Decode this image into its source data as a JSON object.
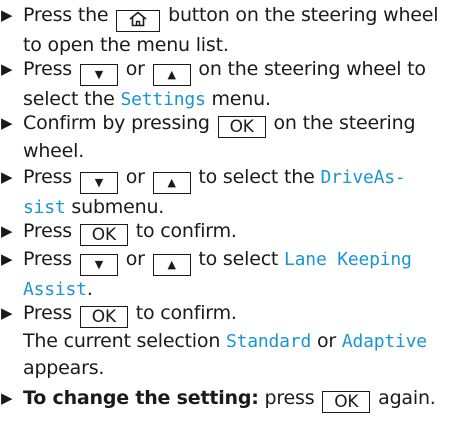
{
  "steps": [
    {
      "a": "Press the ",
      "key": "",
      "b": " button on the steering wheel",
      "c": "to open the menu list."
    },
    {
      "a": "Press ",
      "k1": "▼",
      "or": " or ",
      "k2": "▲",
      "b": " on the steering wheel to",
      "c": "select the ",
      "d": "Settings",
      "e": " menu."
    },
    {
      "a": "Confirm by pressing ",
      "key": "OK",
      "b": " on the steering",
      "c": "wheel."
    },
    {
      "a": "Press ",
      "k1": "▼",
      "or": " or ",
      "k2": "▲",
      "b": " to select the ",
      "d": "DriveAs-",
      "e": "sist",
      "f": " submenu."
    },
    {
      "a": "Press ",
      "key": "OK",
      "b": " to confirm."
    },
    {
      "a": "Press ",
      "k1": "▼",
      "or": " or ",
      "k2": "▲",
      "b": " to select ",
      "d": "Lane Keeping",
      "e": "Assist",
      "f": "."
    },
    {
      "a": "Press ",
      "key": "OK",
      "b": " to confirm.",
      "c": "The current selection ",
      "d": "Standard",
      "e": " or ",
      "f": "Adaptive",
      "g": "appears."
    },
    {
      "bold": "To change the setting:",
      "a": " press ",
      "key": "OK",
      "b": " again."
    }
  ],
  "icons": {
    "bullet": "right-triangle-icon",
    "home": "home-icon"
  },
  "colors": {
    "display_text": "#1996cf",
    "text": "#1a1a1a"
  }
}
